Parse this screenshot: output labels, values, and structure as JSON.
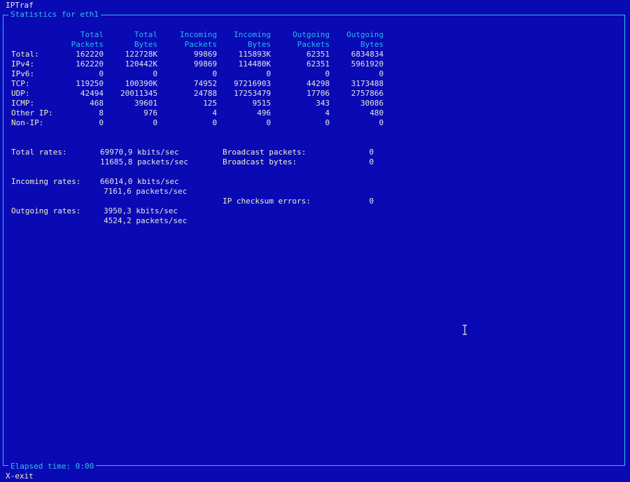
{
  "app": {
    "title": "IPTraf"
  },
  "frame": {
    "title": "Statistics for eth1",
    "elapsed_label": "Elapsed time:",
    "elapsed_value": "0:00"
  },
  "table": {
    "headers": [
      [
        "Total",
        "Packets"
      ],
      [
        "Total",
        "Bytes"
      ],
      [
        "Incoming",
        "Packets"
      ],
      [
        "Incoming",
        "Bytes"
      ],
      [
        "Outgoing",
        "Packets"
      ],
      [
        "Outgoing",
        "Bytes"
      ]
    ],
    "rows": [
      {
        "label": "Total:",
        "values": [
          "162220",
          "122728K",
          "99869",
          "115893K",
          "62351",
          "6834834"
        ]
      },
      {
        "label": "IPv4:",
        "values": [
          "162220",
          "120442K",
          "99869",
          "114480K",
          "62351",
          "5961920"
        ]
      },
      {
        "label": "IPv6:",
        "values": [
          "0",
          "0",
          "0",
          "0",
          "0",
          "0"
        ]
      },
      {
        "label": "TCP:",
        "values": [
          "119250",
          "100390K",
          "74952",
          "97216903",
          "44298",
          "3173488"
        ]
      },
      {
        "label": "UDP:",
        "values": [
          "42494",
          "20011345",
          "24788",
          "17253479",
          "17706",
          "2757866"
        ]
      },
      {
        "label": "ICMP:",
        "values": [
          "468",
          "39601",
          "125",
          "9515",
          "343",
          "30086"
        ]
      },
      {
        "label": "Other IP:",
        "values": [
          "8",
          "976",
          "4",
          "496",
          "4",
          "480"
        ]
      },
      {
        "label": "Non-IP:",
        "values": [
          "0",
          "0",
          "0",
          "0",
          "0",
          "0"
        ]
      }
    ]
  },
  "rates": {
    "total_label": "Total rates:",
    "total_kbits": "69970,9 kbits/sec",
    "total_packets": "11685,8 packets/sec",
    "incoming_label": "Incoming rates:",
    "incoming_kbits": "66014,0 kbits/sec",
    "incoming_packets": "7161,6 packets/sec",
    "outgoing_label": "Outgoing rates:",
    "outgoing_kbits": "3950,3 kbits/sec",
    "outgoing_packets": "4524,2 packets/sec"
  },
  "extra": {
    "broadcast_packets_label": "Broadcast packets:",
    "broadcast_packets_value": "0",
    "broadcast_bytes_label": "Broadcast bytes:",
    "broadcast_bytes_value": "0",
    "ip_checksum_label": "IP checksum errors:",
    "ip_checksum_value": "0"
  },
  "status": {
    "hint": "X-exit"
  },
  "icons": {
    "cursor": "text-cursor-icon"
  },
  "colors": {
    "background": "#0a0ab4",
    "header": "#27b8f0",
    "label": "#f0f0c0",
    "value": "#e4e4e4",
    "frame": "#30c0e8"
  }
}
